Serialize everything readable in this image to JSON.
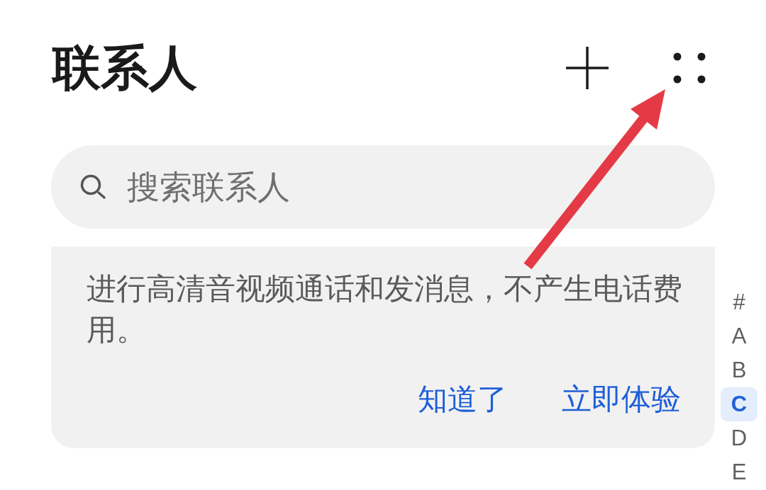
{
  "header": {
    "title": "联系人"
  },
  "search": {
    "placeholder": "搜索联系人"
  },
  "banner": {
    "text": "进行高清音视频通话和发消息，不产生电话费用。",
    "actions": [
      {
        "label": "知道了"
      },
      {
        "label": "立即体验"
      }
    ]
  },
  "index_bar": [
    {
      "label": "#",
      "selected": false
    },
    {
      "label": "A",
      "selected": false
    },
    {
      "label": "B",
      "selected": false
    },
    {
      "label": "C",
      "selected": true
    },
    {
      "label": "D",
      "selected": false
    },
    {
      "label": "E",
      "selected": false
    }
  ]
}
